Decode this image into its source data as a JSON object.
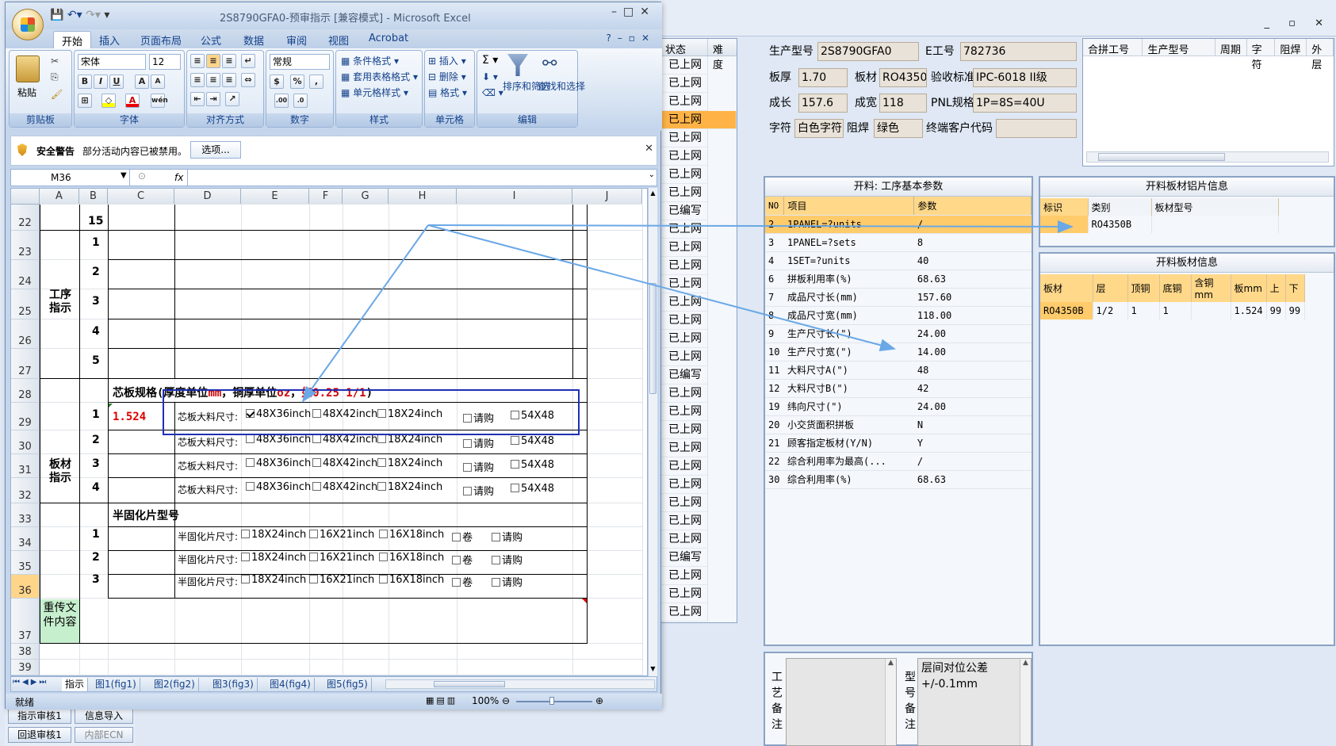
{
  "excel": {
    "title": "2S8790GFA0-预审指示  [兼容模式] - Microsoft Excel",
    "tabs": [
      "开始",
      "插入",
      "页面布局",
      "公式",
      "数据",
      "审阅",
      "视图",
      "Acrobat"
    ],
    "ribbon": {
      "paste": "粘贴",
      "clipboard": "剪贴板",
      "font_name": "宋体",
      "font_size": "12",
      "font_group": "字体",
      "align_group": "对齐方式",
      "number_format": "常规",
      "number_group": "数字",
      "cond_format": "条件格式",
      "table_format": "套用表格格式",
      "cell_style": "单元格样式",
      "style_group": "样式",
      "insert": "插入",
      "delete": "删除",
      "format": "格式",
      "cells_group": "单元格",
      "sort_filter": "排序和筛选",
      "find_select": "查找和选择",
      "edit_group": "编辑"
    },
    "security": {
      "title": "安全警告",
      "text": "部分活动内容已被禁用。",
      "button": "选项..."
    },
    "namebox": "M36",
    "fx": "fx",
    "columns": [
      "A",
      "B",
      "C",
      "D",
      "E",
      "F",
      "G",
      "H",
      "I",
      "J"
    ],
    "rows": [
      "22",
      "23",
      "24",
      "25",
      "26",
      "27",
      "28",
      "29",
      "30",
      "31",
      "32",
      "33",
      "34",
      "35",
      "36",
      "37",
      "38",
      "39"
    ],
    "b22": "15",
    "proc_label": "工序\n指示",
    "proc_nums": [
      "1",
      "2",
      "3",
      "4",
      "5"
    ],
    "core_spec_prefix": "芯板规格(厚度单位",
    "core_spec_mm": "mm",
    "core_spec_mid": "，铜厚单位",
    "core_spec_oz": "oz",
    "core_spec_comma": "，",
    "core_spec_eg": "如0.25 1/1",
    "core_spec_suffix": ")",
    "board_label": "板材\n指示",
    "core_nums": [
      "1",
      "2",
      "3",
      "4"
    ],
    "core_thickness": "1.524",
    "core_size_label": "芯板大料尺寸:",
    "core_sizes": [
      "48X36inch",
      "48X42inch",
      "18X24inch",
      "请购",
      "54X48"
    ],
    "prepreg_title": "半固化片型号",
    "prepreg_nums": [
      "1",
      "2",
      "3"
    ],
    "prepreg_label": "半固化片尺寸:",
    "prepreg_sizes": [
      "18X24inch",
      "16X21inch",
      "16X18inch",
      "卷",
      "请购"
    ],
    "reupload": "重传文\n件内容",
    "sheet_tabs": [
      "指示",
      "图1(fig1)",
      "图2(fig2)",
      "图3(fig3)",
      "图4(fig4)",
      "图5(fig5)"
    ],
    "status": "就绪",
    "zoom": "100%"
  },
  "status_panel": {
    "headers": [
      "状态",
      "难度"
    ],
    "items": [
      "已上网",
      "已上网",
      "已上网",
      "已上网",
      "已上网",
      "已上网",
      "已上网",
      "已上网",
      "已编写",
      "已上网",
      "已上网",
      "已上网",
      "已上网",
      "已上网",
      "已上网",
      "已上网",
      "已上网",
      "已编写",
      "已上网",
      "已上网",
      "已上网",
      "已上网",
      "已上网",
      "已上网",
      "已上网",
      "已上网",
      "已上网",
      "已编写",
      "已上网",
      "已上网",
      "已上网"
    ],
    "selected_index": 3
  },
  "info": {
    "model_label": "生产型号",
    "model": "2S8790GFA0",
    "eno_label": "E工号",
    "eno": "782736",
    "thick_label": "板厚",
    "thick": "1.70",
    "material_label": "板材",
    "material": "RO4350B",
    "standard_label": "验收标准",
    "standard": "IPC-6018 II级",
    "len_label": "成长",
    "len": "157.6",
    "wid_label": "成宽",
    "wid": "118",
    "pnl_label": "PNL规格",
    "pnl": "1P=8S=40U",
    "char_label": "字符",
    "char": "白色字符",
    "mask_label": "阻焊",
    "mask": "绿色",
    "endcode_label": "终端客户代码",
    "endcode": ""
  },
  "merge_headers": [
    "合拼工号",
    "生产型号",
    "周期",
    "字符",
    "阻焊",
    "外层"
  ],
  "process": {
    "title": "开料: 工序基本参数",
    "headers": [
      "NO",
      "项目",
      "参数"
    ],
    "rows": [
      [
        "2",
        "1PANEL=?units",
        "/"
      ],
      [
        "3",
        "1PANEL=?sets",
        "8"
      ],
      [
        "4",
        "1SET=?units",
        "40"
      ],
      [
        "6",
        "拼板利用率(%)",
        "68.63"
      ],
      [
        "7",
        "成品尺寸长(mm)",
        "157.60"
      ],
      [
        "8",
        "成品尺寸宽(mm)",
        "118.00"
      ],
      [
        "9",
        "生产尺寸长(\")",
        "24.00"
      ],
      [
        "10",
        "生产尺寸宽(\")",
        "14.00"
      ],
      [
        "11",
        "大料尺寸A(\")",
        "48"
      ],
      [
        "12",
        "大料尺寸B(\")",
        "42"
      ],
      [
        "19",
        "纬向尺寸(\")",
        "24.00"
      ],
      [
        "20",
        "小交货面积拼板",
        "N"
      ],
      [
        "21",
        "顾客指定板材(Y/N)",
        "Y"
      ],
      [
        "22",
        "综合利用率为最高(...",
        "/"
      ],
      [
        "30",
        "综合利用率(%)",
        "68.63"
      ]
    ],
    "selected_index": 0
  },
  "alu": {
    "title": "开料板材铝片信息",
    "headers": [
      "标识",
      "类别",
      "板材型号"
    ],
    "row": [
      "",
      "RO4350B",
      ""
    ]
  },
  "board": {
    "title": "开料板材信息",
    "headers": [
      "板材",
      "层",
      "顶铜",
      "底铜",
      "含铜mm",
      "板mm",
      "上",
      "下"
    ],
    "row": [
      "RO4350B",
      "1/2",
      "1",
      "1",
      "",
      "1.524",
      "99",
      "99"
    ]
  },
  "notes": {
    "craft_label": "工艺备注",
    "model_label": "型号备注",
    "model_note": "层间对位公差+/-0.1mm"
  },
  "bottom_buttons": [
    "指示审核1",
    "信息导入",
    "回退审核1",
    "内部ECN"
  ]
}
